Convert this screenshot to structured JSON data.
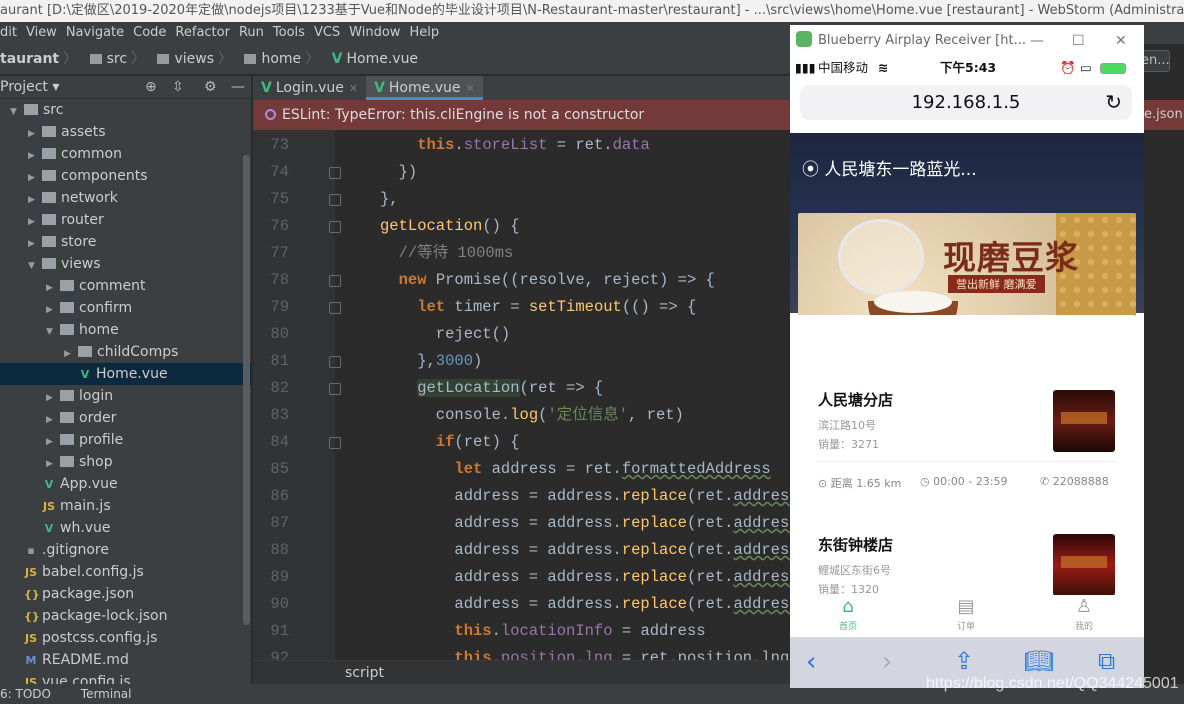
{
  "window_title": "aurant [D:\\定做区\\2019-2020年定做\\nodejs项目\\1233基于Vue和Node的毕业设计项目\\N-Restaurant-master\\restaurant] - ...\\src\\views\\home\\Home.vue [restaurant] - WebStorm (Administrator)",
  "menu": [
    "dit",
    "View",
    "Navigate",
    "Code",
    "Refactor",
    "Run",
    "Tools",
    "VCS",
    "Window",
    "Help"
  ],
  "breadcrumb": [
    "taurant",
    "src",
    "views",
    "home",
    "Home.vue"
  ],
  "project": {
    "title": "Project",
    "tree": [
      {
        "label": "src",
        "depth": 0,
        "type": "folder",
        "open": true
      },
      {
        "label": "assets",
        "depth": 1,
        "type": "folder"
      },
      {
        "label": "common",
        "depth": 1,
        "type": "folder"
      },
      {
        "label": "components",
        "depth": 1,
        "type": "folder"
      },
      {
        "label": "network",
        "depth": 1,
        "type": "folder"
      },
      {
        "label": "router",
        "depth": 1,
        "type": "folder"
      },
      {
        "label": "store",
        "depth": 1,
        "type": "folder"
      },
      {
        "label": "views",
        "depth": 1,
        "type": "folder",
        "open": true
      },
      {
        "label": "comment",
        "depth": 2,
        "type": "folder"
      },
      {
        "label": "confirm",
        "depth": 2,
        "type": "folder"
      },
      {
        "label": "home",
        "depth": 2,
        "type": "folder",
        "open": true
      },
      {
        "label": "childComps",
        "depth": 3,
        "type": "folder"
      },
      {
        "label": "Home.vue",
        "depth": 3,
        "type": "vue",
        "selected": true
      },
      {
        "label": "login",
        "depth": 2,
        "type": "folder"
      },
      {
        "label": "order",
        "depth": 2,
        "type": "folder"
      },
      {
        "label": "profile",
        "depth": 2,
        "type": "folder"
      },
      {
        "label": "shop",
        "depth": 2,
        "type": "folder"
      },
      {
        "label": "App.vue",
        "depth": 1,
        "type": "vue"
      },
      {
        "label": "main.js",
        "depth": 1,
        "type": "js"
      },
      {
        "label": "wh.vue",
        "depth": 1,
        "type": "vue"
      },
      {
        "label": ".gitignore",
        "depth": 0,
        "type": "file"
      },
      {
        "label": "babel.config.js",
        "depth": 0,
        "type": "js"
      },
      {
        "label": "package.json",
        "depth": 0,
        "type": "json"
      },
      {
        "label": "package-lock.json",
        "depth": 0,
        "type": "json"
      },
      {
        "label": "postcss.config.js",
        "depth": 0,
        "type": "js"
      },
      {
        "label": "README.md",
        "depth": 0,
        "type": "md"
      },
      {
        "label": "vue.config.js",
        "depth": 0,
        "type": "js"
      }
    ]
  },
  "tabs": [
    {
      "label": "Login.vue",
      "active": false
    },
    {
      "label": "Home.vue",
      "active": true
    }
  ],
  "error_banner": "ESLint: TypeError: this.cliEngine is not a constructor",
  "right_fragments": {
    "button": "en...",
    "json": "e.json"
  },
  "code": [
    {
      "n": "73",
      "i": 2,
      "tk": [
        [
          "k",
          "this"
        ],
        [
          "t",
          "."
        ],
        [
          "p",
          "storeList"
        ],
        [
          "t",
          " = ret."
        ],
        [
          "p",
          "data"
        ]
      ]
    },
    {
      "n": "74",
      "i": 1,
      "tk": [
        [
          "t",
          "})"
        ]
      ]
    },
    {
      "n": "75",
      "i": 0,
      "tk": [
        [
          "t",
          "},"
        ]
      ]
    },
    {
      "n": "76",
      "i": 0,
      "tk": [
        [
          "f",
          "getLocation"
        ],
        [
          "t",
          "() {"
        ]
      ]
    },
    {
      "n": "77",
      "i": 1,
      "tk": [
        [
          "c",
          "//等待 1000ms"
        ]
      ]
    },
    {
      "n": "78",
      "i": 1,
      "tk": [
        [
          "k",
          "new "
        ],
        [
          "t",
          "Promise((resolve, reject) => {"
        ]
      ]
    },
    {
      "n": "79",
      "i": 2,
      "tk": [
        [
          "k",
          "let "
        ],
        [
          "t",
          "timer = "
        ],
        [
          "f",
          "setTimeout"
        ],
        [
          "t",
          "(() => {"
        ]
      ]
    },
    {
      "n": "80",
      "i": 3,
      "tk": [
        [
          "t",
          "reject()"
        ]
      ]
    },
    {
      "n": "81",
      "i": 2,
      "tk": [
        [
          "t",
          "},"
        ],
        [
          "n",
          "3000"
        ],
        [
          "t",
          ")"
        ]
      ]
    },
    {
      "n": "82",
      "i": 2,
      "tk": [
        [
          "hl",
          "getLocation"
        ],
        [
          "t",
          "(ret => {"
        ]
      ]
    },
    {
      "n": "83",
      "i": 3,
      "tk": [
        [
          "t",
          "console."
        ],
        [
          "f",
          "log"
        ],
        [
          "t",
          "("
        ],
        [
          "s",
          "'定位信息'"
        ],
        [
          "t",
          ", ret)"
        ]
      ]
    },
    {
      "n": "84",
      "i": 3,
      "tk": [
        [
          "k",
          "if"
        ],
        [
          "t",
          "(ret) {"
        ]
      ]
    },
    {
      "n": "85",
      "i": 4,
      "tk": [
        [
          "k",
          "let "
        ],
        [
          "t",
          "address = ret."
        ],
        [
          "u",
          "formattedAddress"
        ]
      ]
    },
    {
      "n": "86",
      "i": 4,
      "tk": [
        [
          "t",
          "address = address."
        ],
        [
          "f",
          "replace"
        ],
        [
          "t",
          "(ret."
        ],
        [
          "u",
          "address("
        ]
      ]
    },
    {
      "n": "87",
      "i": 4,
      "tk": [
        [
          "t",
          "address = address."
        ],
        [
          "f",
          "replace"
        ],
        [
          "t",
          "(ret."
        ],
        [
          "u",
          "address("
        ]
      ]
    },
    {
      "n": "88",
      "i": 4,
      "tk": [
        [
          "t",
          "address = address."
        ],
        [
          "f",
          "replace"
        ],
        [
          "t",
          "(ret."
        ],
        [
          "u",
          "address("
        ]
      ]
    },
    {
      "n": "89",
      "i": 4,
      "tk": [
        [
          "t",
          "address = address."
        ],
        [
          "f",
          "replace"
        ],
        [
          "t",
          "(ret."
        ],
        [
          "u",
          "address("
        ]
      ]
    },
    {
      "n": "90",
      "i": 4,
      "tk": [
        [
          "t",
          "address = address."
        ],
        [
          "f",
          "replace"
        ],
        [
          "t",
          "(ret."
        ],
        [
          "u",
          "address("
        ]
      ]
    },
    {
      "n": "91",
      "i": 4,
      "tk": [
        [
          "k",
          "this"
        ],
        [
          "t",
          "."
        ],
        [
          "p",
          "locationInfo"
        ],
        [
          "t",
          " = address"
        ]
      ]
    },
    {
      "n": "92",
      "i": 4,
      "tk": [
        [
          "k",
          "this"
        ],
        [
          "t",
          "."
        ],
        [
          "p",
          "position.lng"
        ],
        [
          "t",
          " = ret.position.lng"
        ]
      ]
    }
  ],
  "status_context": "script",
  "bottom_tools": [
    "6: TODO",
    "Terminal"
  ],
  "phone": {
    "window_title": "Blueberry Airplay Receiver [ht...",
    "carrier": "中国移动",
    "time": "下午5:43",
    "battery_color": "#4cd964",
    "url": "192.168.1.5",
    "location": "人民塘东一路蓝光...",
    "ad": {
      "title": "现磨豆浆",
      "subtitle": "营出新鲜 磨满爱"
    },
    "stores": [
      {
        "name": "人民塘分店",
        "address": "滨江路10号",
        "sales": "销量：3271",
        "distance": "距离 1.65 km",
        "hours": "00:00 - 23:59",
        "phone": "22088888"
      },
      {
        "name": "东街钟楼店",
        "address": "鲤城区东街6号",
        "sales": "销量：1320"
      }
    ],
    "tabbar": [
      {
        "label": "首页",
        "active": true
      },
      {
        "label": "订单"
      },
      {
        "label": "我的"
      }
    ],
    "accent": "#41b883"
  },
  "watermark": "https://blog.csdn.net/QQ344245001"
}
